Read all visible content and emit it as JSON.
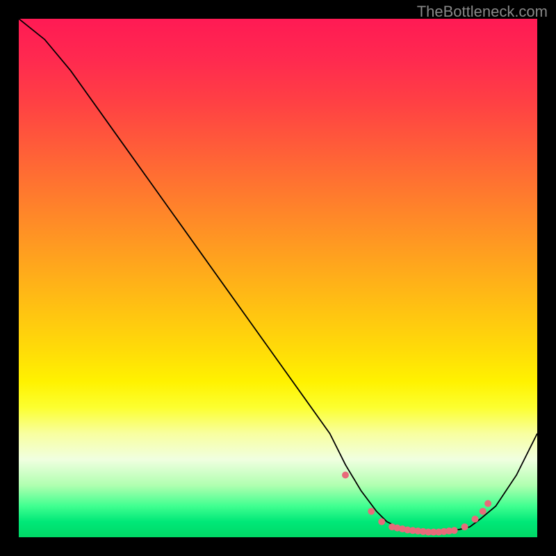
{
  "attribution": "TheBottleneck.com",
  "chart_data": {
    "type": "line",
    "title": "",
    "xlabel": "",
    "ylabel": "",
    "xlim": [
      0,
      100
    ],
    "ylim": [
      0,
      100
    ],
    "series": [
      {
        "name": "bottleneck-curve",
        "x": [
          0,
          5,
          10,
          15,
          20,
          25,
          30,
          35,
          40,
          45,
          50,
          55,
          60,
          63,
          66,
          69,
          71,
          73,
          75,
          77,
          79,
          81,
          83,
          85,
          87,
          89,
          92,
          96,
          100
        ],
        "y": [
          100,
          96,
          90,
          83,
          76,
          69,
          62,
          55,
          48,
          41,
          34,
          27,
          20,
          14,
          9,
          5,
          3,
          2,
          1.5,
          1,
          1,
          1,
          1.2,
          1.5,
          2,
          3.5,
          6,
          12,
          20
        ]
      }
    ],
    "markers": {
      "name": "highlight-points",
      "color": "#e86b7a",
      "x": [
        63,
        68,
        70,
        72,
        73,
        74,
        75,
        76,
        77,
        78,
        79,
        80,
        81,
        82,
        83,
        84,
        86,
        88,
        89.5,
        90.5
      ],
      "y": [
        12,
        5,
        3,
        2,
        1.8,
        1.6,
        1.4,
        1.3,
        1.2,
        1.1,
        1,
        1,
        1,
        1.1,
        1.2,
        1.3,
        2,
        3.5,
        5,
        6.5
      ]
    },
    "gradient": {
      "description": "Vertical red-to-green gradient representing bottleneck severity",
      "top_color": "#ff1a54",
      "bottom_color": "#00d866"
    }
  }
}
